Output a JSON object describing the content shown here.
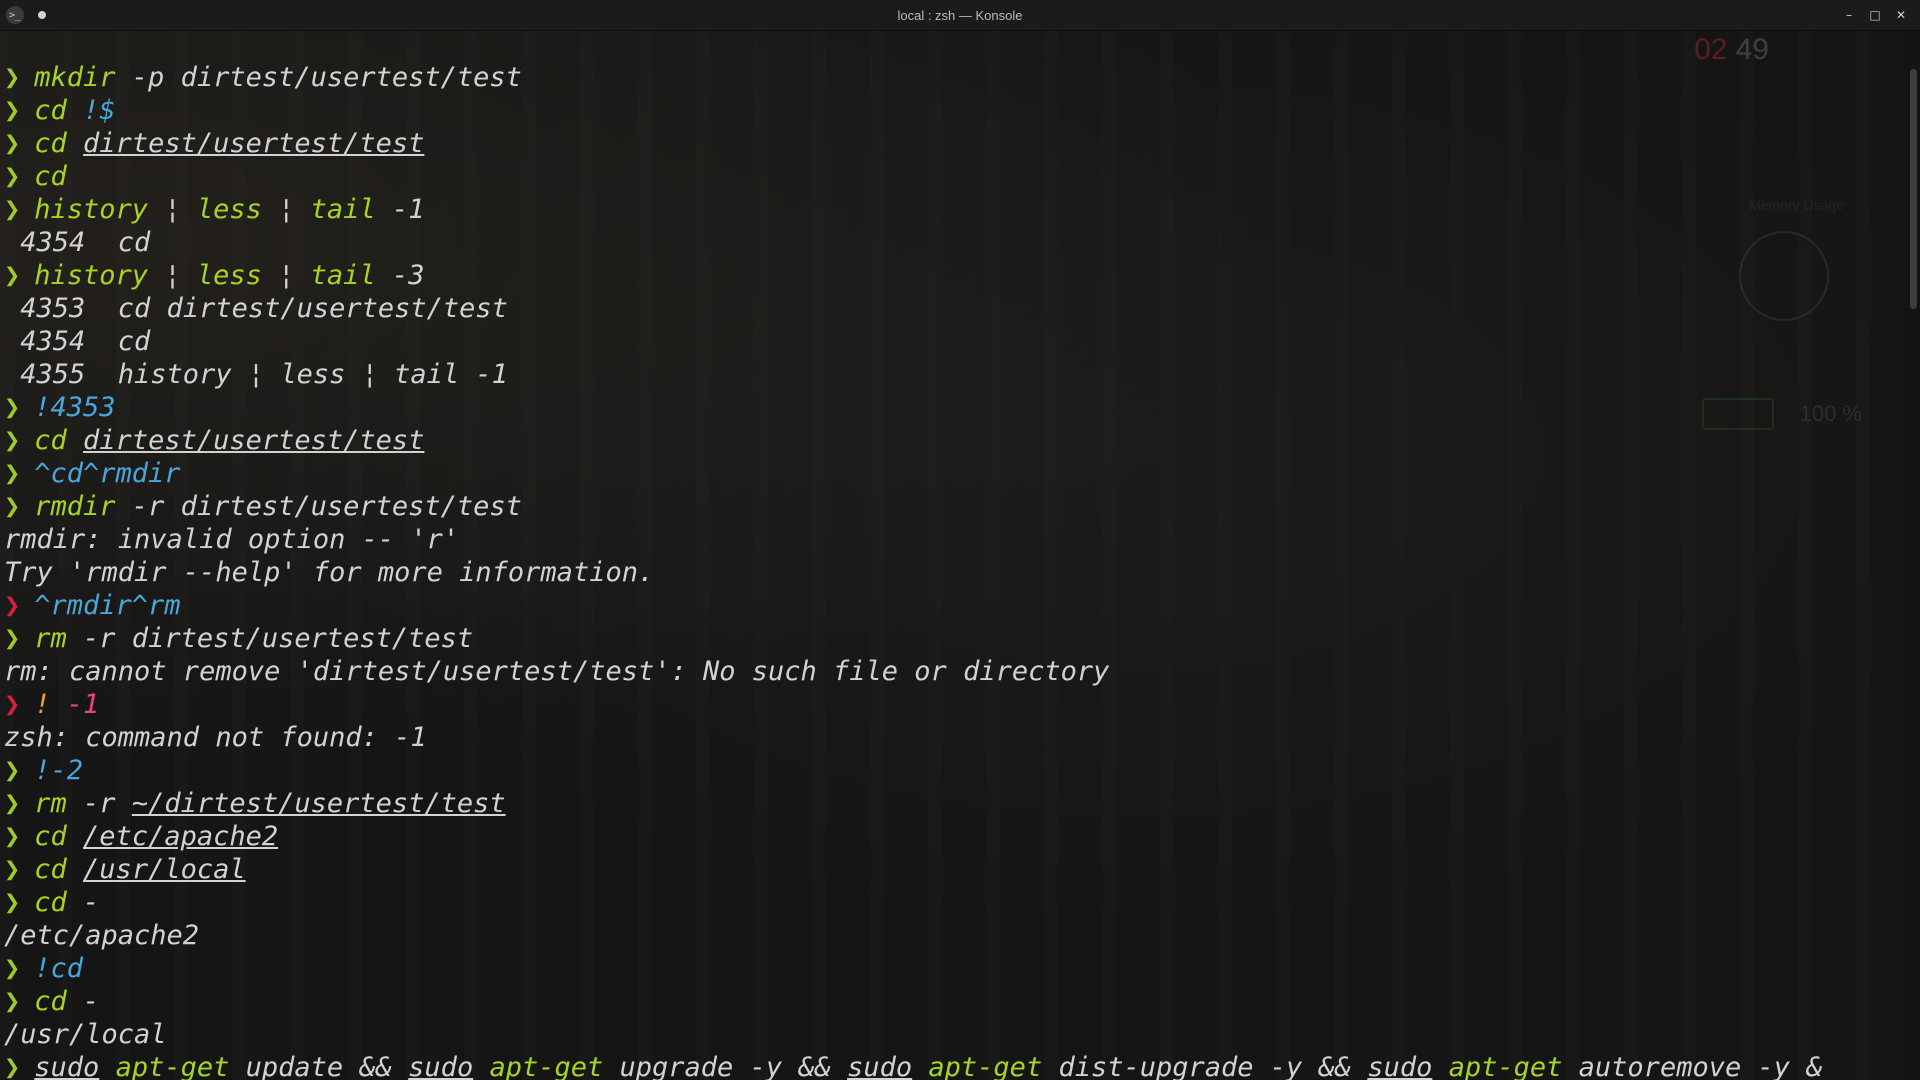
{
  "window": {
    "title": "local : zsh — Konsole",
    "app_icon": "konsole-icon",
    "controls": {
      "minimize": "–",
      "maximize": "□",
      "close": "✕"
    }
  },
  "widgets": {
    "clock_hours": "02",
    "clock_minutes": "49",
    "memory_label": "Memory Usage",
    "battery_percent": "100 %"
  },
  "prompt_symbol": "❯",
  "colors": {
    "prompt_ok": "#9ecb2c",
    "prompt_error": "#d8213c",
    "command": "#a6d423",
    "history_expansion": "#47a7d8",
    "background": "#151515"
  },
  "lines": [
    {
      "prompt": "ok",
      "segs": [
        {
          "c": "cmd",
          "t": "mkdir"
        },
        {
          "c": "arg",
          "t": " -p dirtest/usertest/test"
        }
      ]
    },
    {
      "prompt": "ok",
      "segs": [
        {
          "c": "cmd",
          "t": "cd "
        },
        {
          "c": "sub",
          "t": "!$"
        }
      ]
    },
    {
      "prompt": "ok",
      "segs": [
        {
          "c": "cmd",
          "t": "cd "
        },
        {
          "c": "path",
          "t": "dirtest/usertest/test"
        }
      ]
    },
    {
      "prompt": "ok",
      "segs": [
        {
          "c": "cmd",
          "t": "cd"
        }
      ]
    },
    {
      "prompt": "ok",
      "segs": [
        {
          "c": "cmd",
          "t": "history"
        },
        {
          "c": "pipe",
          "t": " ¦ "
        },
        {
          "c": "cmd",
          "t": "less"
        },
        {
          "c": "pipe",
          "t": " ¦ "
        },
        {
          "c": "cmd",
          "t": "tail"
        },
        {
          "c": "arg",
          "t": " -1"
        }
      ]
    },
    {
      "prompt": "none",
      "segs": [
        {
          "c": "out",
          "t": " 4354  cd"
        }
      ]
    },
    {
      "prompt": "ok",
      "segs": [
        {
          "c": "cmd",
          "t": "history"
        },
        {
          "c": "pipe",
          "t": " ¦ "
        },
        {
          "c": "cmd",
          "t": "less"
        },
        {
          "c": "pipe",
          "t": " ¦ "
        },
        {
          "c": "cmd",
          "t": "tail"
        },
        {
          "c": "arg",
          "t": " -3"
        }
      ]
    },
    {
      "prompt": "none",
      "segs": [
        {
          "c": "out",
          "t": " 4353  cd dirtest/usertest/test"
        }
      ]
    },
    {
      "prompt": "none",
      "segs": [
        {
          "c": "out",
          "t": " 4354  cd"
        }
      ]
    },
    {
      "prompt": "none",
      "segs": [
        {
          "c": "out",
          "t": " 4355  history ¦ less ¦ tail -1"
        }
      ]
    },
    {
      "prompt": "ok",
      "segs": [
        {
          "c": "sub",
          "t": "!4353"
        }
      ]
    },
    {
      "prompt": "ok",
      "segs": [
        {
          "c": "cmd",
          "t": "cd "
        },
        {
          "c": "path",
          "t": "dirtest/usertest/test"
        }
      ]
    },
    {
      "prompt": "ok",
      "segs": [
        {
          "c": "sub",
          "t": "^cd^rmdir"
        }
      ]
    },
    {
      "prompt": "ok",
      "segs": [
        {
          "c": "cmd",
          "t": "rmdir"
        },
        {
          "c": "arg",
          "t": " -r dirtest/usertest/test"
        }
      ]
    },
    {
      "prompt": "none",
      "segs": [
        {
          "c": "out",
          "t": "rmdir: invalid option -- 'r'"
        }
      ]
    },
    {
      "prompt": "none",
      "segs": [
        {
          "c": "out",
          "t": "Try 'rmdir --help' for more information."
        }
      ]
    },
    {
      "prompt": "err",
      "segs": [
        {
          "c": "sub",
          "t": "^rmdir^rm"
        }
      ]
    },
    {
      "prompt": "ok",
      "segs": [
        {
          "c": "cmd",
          "t": "rm"
        },
        {
          "c": "arg",
          "t": " -r dirtest/usertest/test"
        }
      ]
    },
    {
      "prompt": "none",
      "segs": [
        {
          "c": "out",
          "t": "rm: cannot remove 'dirtest/usertest/test': No such file or directory"
        }
      ]
    },
    {
      "prompt": "err",
      "segs": [
        {
          "c": "bang",
          "t": "!"
        },
        {
          "c": "neg",
          "t": " -1"
        }
      ]
    },
    {
      "prompt": "none",
      "segs": [
        {
          "c": "out",
          "t": "zsh: command not found: -1"
        }
      ]
    },
    {
      "prompt": "ok",
      "segs": [
        {
          "c": "sub",
          "t": "!-2"
        }
      ]
    },
    {
      "prompt": "ok",
      "segs": [
        {
          "c": "cmd",
          "t": "rm"
        },
        {
          "c": "arg",
          "t": " -r "
        },
        {
          "c": "path",
          "t": "~/dirtest/usertest/test"
        }
      ]
    },
    {
      "prompt": "ok",
      "segs": [
        {
          "c": "cmd",
          "t": "cd "
        },
        {
          "c": "path",
          "t": "/etc/apache2"
        }
      ]
    },
    {
      "prompt": "ok",
      "segs": [
        {
          "c": "cmd",
          "t": "cd "
        },
        {
          "c": "path",
          "t": "/usr/local"
        }
      ]
    },
    {
      "prompt": "ok",
      "segs": [
        {
          "c": "cmd",
          "t": "cd"
        },
        {
          "c": "arg",
          "t": " -"
        }
      ]
    },
    {
      "prompt": "none",
      "segs": [
        {
          "c": "out",
          "t": "/etc/apache2"
        }
      ]
    },
    {
      "prompt": "ok",
      "segs": [
        {
          "c": "sub",
          "t": "!cd"
        }
      ]
    },
    {
      "prompt": "ok",
      "segs": [
        {
          "c": "cmd",
          "t": "cd"
        },
        {
          "c": "arg",
          "t": " -"
        }
      ]
    },
    {
      "prompt": "none",
      "segs": [
        {
          "c": "out",
          "t": "/usr/local"
        }
      ]
    },
    {
      "prompt": "ok",
      "segs": [
        {
          "c": "path cmd",
          "t": "sudo"
        },
        {
          "c": "arg",
          "t": " "
        },
        {
          "c": "cmd",
          "t": "apt-get"
        },
        {
          "c": "arg",
          "t": " update && "
        },
        {
          "c": "path cmd",
          "t": "sudo"
        },
        {
          "c": "arg",
          "t": " "
        },
        {
          "c": "cmd",
          "t": "apt-get"
        },
        {
          "c": "arg",
          "t": " upgrade -y && "
        },
        {
          "c": "path cmd",
          "t": "sudo"
        },
        {
          "c": "arg",
          "t": " "
        },
        {
          "c": "cmd",
          "t": "apt-get"
        },
        {
          "c": "arg",
          "t": " dist-upgrade -y && "
        },
        {
          "c": "path cmd",
          "t": "sudo"
        },
        {
          "c": "arg",
          "t": " "
        },
        {
          "c": "cmd",
          "t": "apt-get"
        },
        {
          "c": "arg",
          "t": " autoremove -y &"
        }
      ]
    }
  ]
}
